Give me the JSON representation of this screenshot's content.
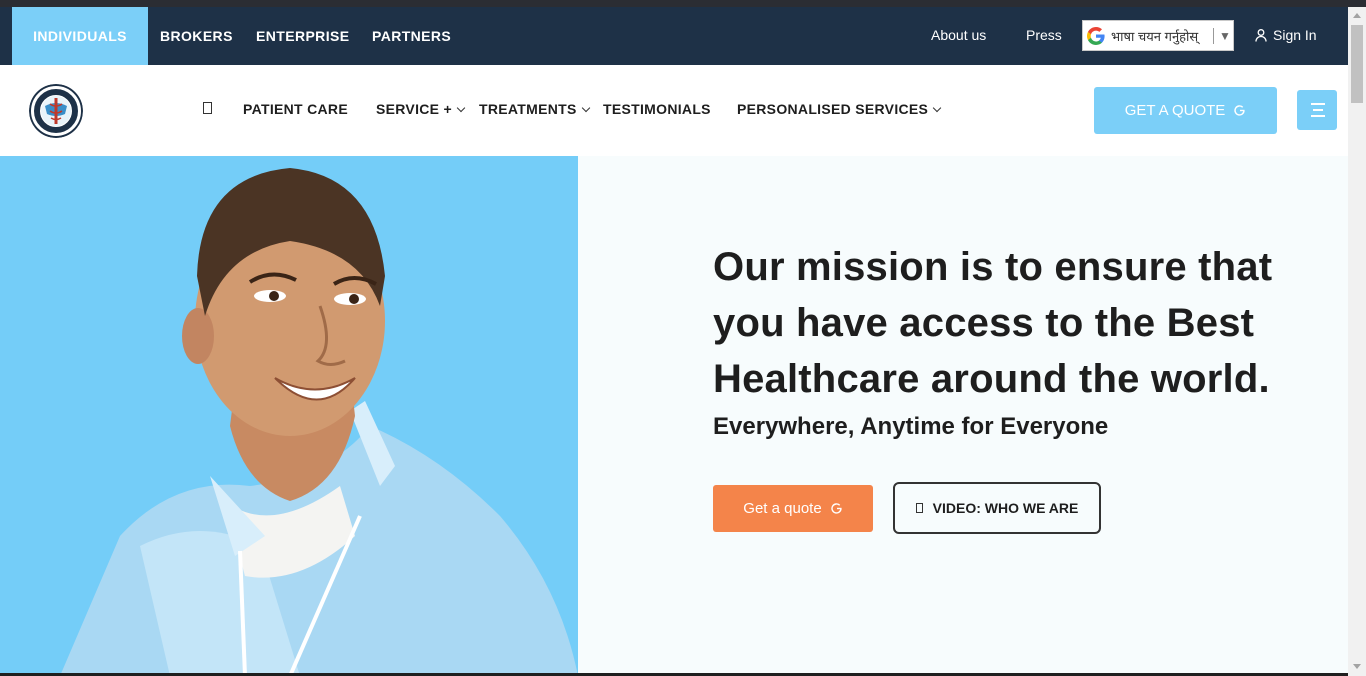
{
  "topbar": {
    "segments": {
      "individuals": "INDIVIDUALS",
      "brokers": "BROKERS",
      "enterprise": "ENTERPRISE",
      "partners": "PARTNERS"
    },
    "active_segment": "INDIVIDUALS",
    "about_label": "About us",
    "press_label": "Press",
    "language_selector": "भाषा चयन गर्नुहोस्",
    "sign_in_label": "Sign In"
  },
  "nav": {
    "items": [
      {
        "label": "PATIENT CARE"
      },
      {
        "label": "SERVICE +"
      },
      {
        "label": "TREATMENTS"
      },
      {
        "label": "TESTIMONIALS"
      },
      {
        "label": "PERSONALISED SERVICES"
      }
    ],
    "quote_label": "GET A QUOTE"
  },
  "hero": {
    "title": "Our mission is to ensure that you have access to the Best Healthcare around the world.",
    "subtitle": "Everywhere, Anytime for Everyone",
    "quote_label": "Get a quote",
    "video_label": "VIDEO: WHO WE ARE"
  },
  "colors": {
    "topbar_bg": "#1e3147",
    "accent_blue": "#7bcff8",
    "accent_orange": "#f4844a",
    "hero_bg": "#f7fcfd",
    "text_dark": "#1e1e1e"
  },
  "icons": {
    "language": "google-g-icon",
    "sign_in": "user-icon",
    "home": "home-icon",
    "quote": "refresh-arrow-icon",
    "menu": "hamburger-menu-icon",
    "video": "play-icon"
  }
}
